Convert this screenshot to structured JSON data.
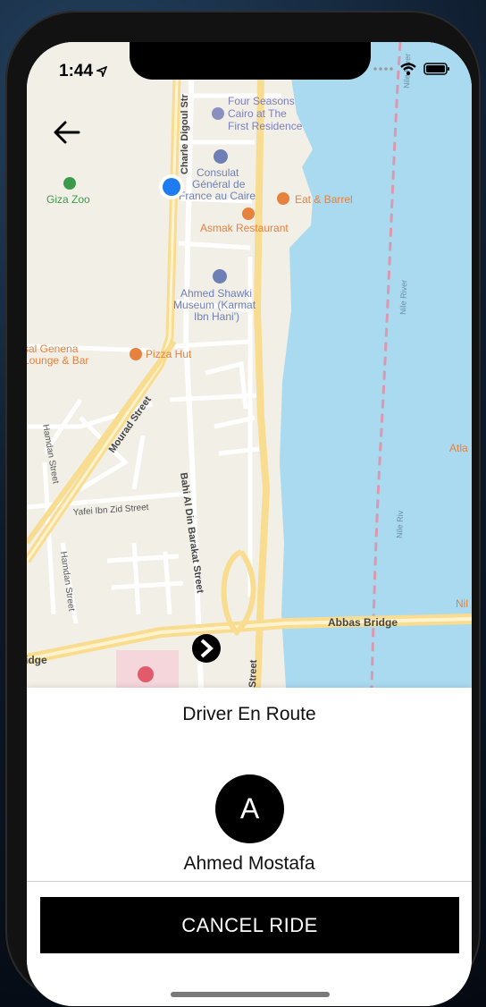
{
  "status_bar": {
    "time": "1:44"
  },
  "map": {
    "labels": {
      "four_seasons": [
        "Four Seasons",
        "Cairo at The",
        "First Residence"
      ],
      "giza_zoo": "Giza Zoo",
      "consulat": [
        "Consulat",
        "Général de",
        "France au Caire"
      ],
      "eat_barrel": "Eat & Barrel",
      "asmak": "Asmak Restaurant",
      "museum": [
        "Ahmed Shawki",
        "Museum (Karmat",
        "Ibn Hani')"
      ],
      "genena": [
        "sal Genena",
        "Lounge & Bar"
      ],
      "pizza_hut": "Pizza Hut",
      "mourad": "Mourad Street",
      "charle": "Charle Digoul Str",
      "hamdan1": "Hamdan Street",
      "hamdan2": "Hamdan Street",
      "yafei": "Yafei Ibn Zid Street",
      "bahi": "Bahi Al Din Barakat Street",
      "nile1": "Nile River",
      "nile2": "Nile River",
      "nile3": "Nile Riv",
      "abbas": "Abbas Bridge",
      "bridge_left": "idge",
      "atla": "Atla",
      "nil": "Nil",
      "street_bottom": "Street"
    }
  },
  "sheet": {
    "title": "Driver En Route",
    "avatar_initial": "A",
    "driver_name": "Ahmed Mostafa",
    "cancel_label": "CANCEL RIDE"
  },
  "colors": {
    "land": "#f2efe7",
    "water": "#aadaf0",
    "road": "#ffffff",
    "major_road": "#f8dc8f",
    "user_dot": "#1e7cf0",
    "poi_orange": "#e6813e",
    "poi_blue": "#6e7fb5",
    "poi_green": "#3b9a4b",
    "button_bg": "#000000"
  }
}
